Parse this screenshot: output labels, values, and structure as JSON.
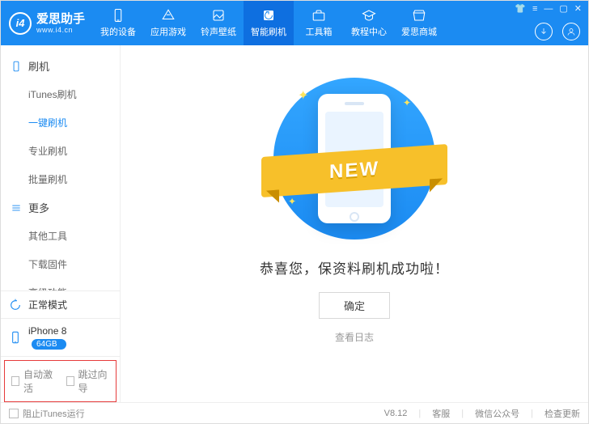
{
  "brand": {
    "logo": "i4",
    "title": "爱思助手",
    "url": "www.i4.cn"
  },
  "topnav": {
    "items": [
      {
        "label": "我的设备"
      },
      {
        "label": "应用游戏"
      },
      {
        "label": "铃声壁纸"
      },
      {
        "label": "智能刷机"
      },
      {
        "label": "工具箱"
      },
      {
        "label": "教程中心"
      },
      {
        "label": "爱思商城"
      }
    ],
    "active_index": 3
  },
  "sidebar": {
    "groups": [
      {
        "icon": "phone",
        "title": "刷机",
        "items": [
          "iTunes刷机",
          "一键刷机",
          "专业刷机",
          "批量刷机"
        ],
        "active_index": 1
      },
      {
        "icon": "menu",
        "title": "更多",
        "items": [
          "其他工具",
          "下载固件",
          "高级功能"
        ]
      }
    ],
    "mode_label": "正常模式",
    "device": {
      "name": "iPhone 8",
      "storage": "64GB"
    },
    "checkboxes": {
      "auto_activate": "自动激活",
      "skip_setup": "跳过向导"
    }
  },
  "main": {
    "ribbon": "NEW",
    "success_title": "恭喜您，保资料刷机成功啦！",
    "confirm_label": "确定",
    "view_log_label": "查看日志"
  },
  "footer": {
    "block_itunes_label": "阻止iTunes运行",
    "version": "V8.12",
    "links": [
      "客服",
      "微信公众号",
      "检查更新"
    ]
  }
}
